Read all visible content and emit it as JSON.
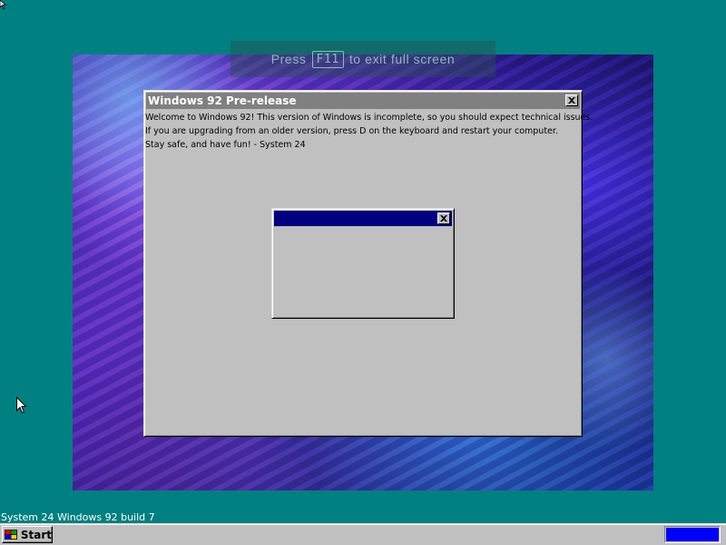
{
  "fullscreen_hint": {
    "press": "Press",
    "key": "F11",
    "rest": "to exit full screen"
  },
  "main_window": {
    "title": "Windows 92 Pre-release",
    "lines": [
      "Welcome to Windows 92! This version of Windows is incomplete, so you should expect technical issues.",
      "If you are upgrading from an older version, press D on the keyboard and restart your computer.",
      "Stay safe, and have fun! - System 24"
    ],
    "close_icon": "close-x-icon"
  },
  "sub_window": {
    "title": "",
    "close_icon": "close-x-icon"
  },
  "build_label": "System 24 Windows 92 build 7",
  "taskbar": {
    "start_label": "Start",
    "start_icon": "windows-logo-icon",
    "tray_color": "#0000ff"
  },
  "colors": {
    "desktop": "#008080",
    "active_title": "#000080",
    "inactive_title": "#808080",
    "face": "#c0c0c0"
  }
}
